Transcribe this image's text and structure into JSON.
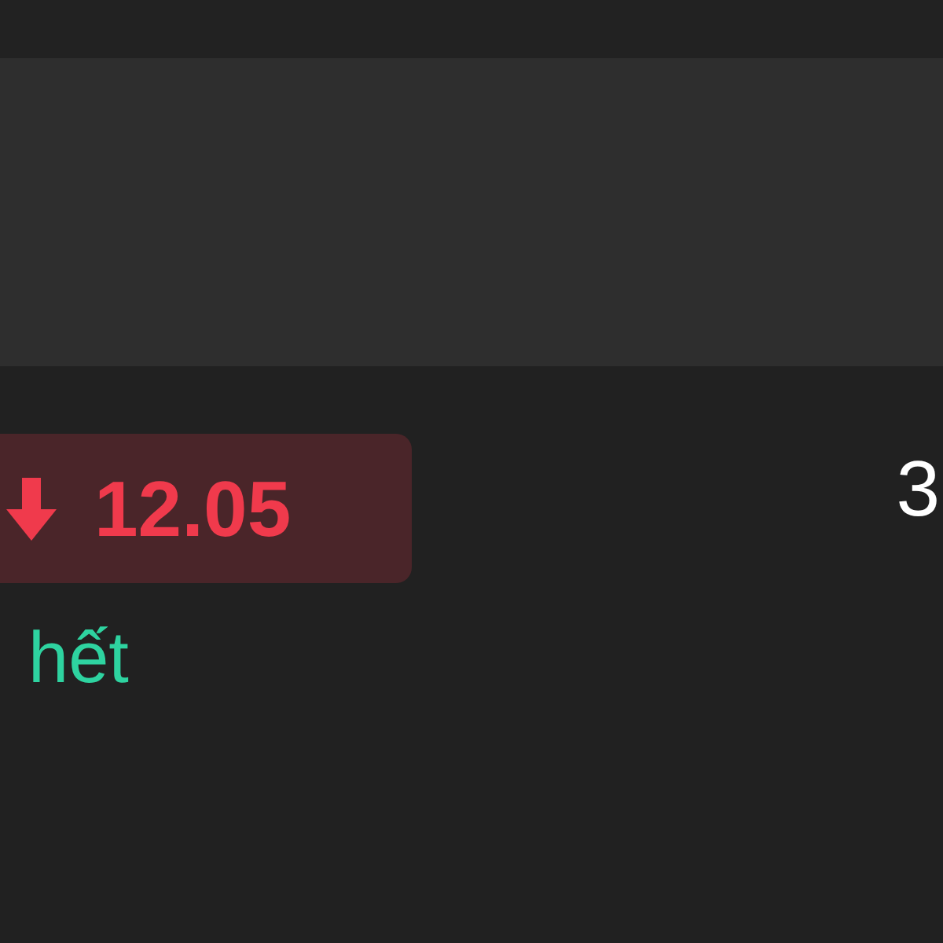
{
  "price_change": {
    "falling": true,
    "value": "12.05"
  },
  "right_value": "3",
  "link": {
    "label": "hết"
  }
}
